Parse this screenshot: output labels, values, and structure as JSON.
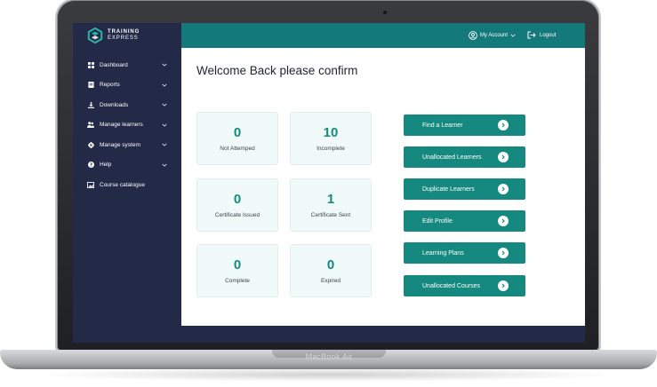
{
  "device": {
    "model_label": "MacBook Air"
  },
  "brand": {
    "line1": "TRAINING",
    "line2": "EXPRESS",
    "accent": "#2bb3a6"
  },
  "colors": {
    "sidebar": "#222a47",
    "topbar": "#14797b",
    "button": "#15897f",
    "card_bg": "#f0faf9",
    "value": "#15897f"
  },
  "sidebar": {
    "items": [
      {
        "label": "Dashboard",
        "icon": "grid-icon",
        "chevron": true
      },
      {
        "label": "Reports",
        "icon": "report-icon",
        "chevron": true
      },
      {
        "label": "Downloads",
        "icon": "download-icon",
        "chevron": true
      },
      {
        "label": "Manage learners",
        "icon": "users-icon",
        "chevron": true
      },
      {
        "label": "Manage system",
        "icon": "gear-icon",
        "chevron": true
      },
      {
        "label": "Help",
        "icon": "help-icon",
        "chevron": true
      },
      {
        "label": "Course catalogue",
        "icon": "catalogue-icon",
        "chevron": false
      }
    ]
  },
  "header": {
    "account_label": "My Account",
    "logout_label": "Logout"
  },
  "main": {
    "welcome": "Welcome Back please confirm",
    "stats": [
      {
        "value": "0",
        "label": "Not Attemped"
      },
      {
        "value": "10",
        "label": "Incomplete"
      },
      {
        "value": "0",
        "label": "Certificate Issued"
      },
      {
        "value": "1",
        "label": "Certificate Sent"
      },
      {
        "value": "0",
        "label": "Complete"
      },
      {
        "value": "0",
        "label": "Expired"
      }
    ],
    "actions": [
      {
        "label": "Find a Learner"
      },
      {
        "label": "Unallocated Learners"
      },
      {
        "label": "Duplicate Learners"
      },
      {
        "label": "Edit Profile"
      },
      {
        "label": "Learning Plans"
      },
      {
        "label": "Unallocated Courses"
      }
    ]
  }
}
